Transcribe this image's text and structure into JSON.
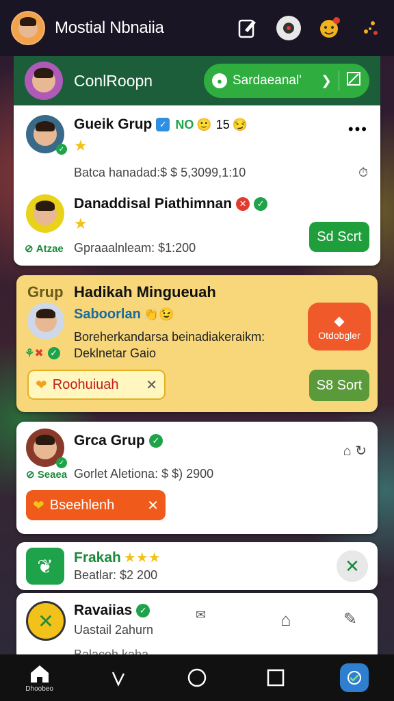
{
  "topbar": {
    "title": "Mostial Nbnaiia"
  },
  "group_header": {
    "title": "ConlRoopn",
    "pill_label": "Sardaeanal'"
  },
  "card1": {
    "row1": {
      "name": "Gueik Grup",
      "badge_text": "NO",
      "count": "15",
      "detail": "Batca hanadad:$ $ 5,3099,1:10"
    },
    "row2": {
      "name": "Danaddisal Piathimnan",
      "status": "Atzae",
      "detail": "Gpraaalnleam: $1:200",
      "button": "Sd Scrt"
    }
  },
  "card2": {
    "group_label": "Grup",
    "name": "Hadikah Mingueuah",
    "subname": "Saboorlan",
    "line1": "Boreherkandarsa beinadiakeraikm:",
    "line2": "Deklnetar Gaio",
    "chip": "Roohuiuah",
    "orange_badge": "Otdobgler",
    "button": "S8 Sort"
  },
  "card3": {
    "name": "Grca Grup",
    "status": "Seaea",
    "detail": "Gorlet Aletiona: $ $) 2900",
    "chip": "Bseehlenh"
  },
  "card4": {
    "name": "Frakah",
    "detail": "Beatlar: $2 200"
  },
  "card5": {
    "name": "Ravaiias",
    "detail": "Uastail 2ahurn",
    "detail2": "Balaceh kaha ..."
  },
  "navbar": {
    "home_label": "Dhoobeo"
  }
}
